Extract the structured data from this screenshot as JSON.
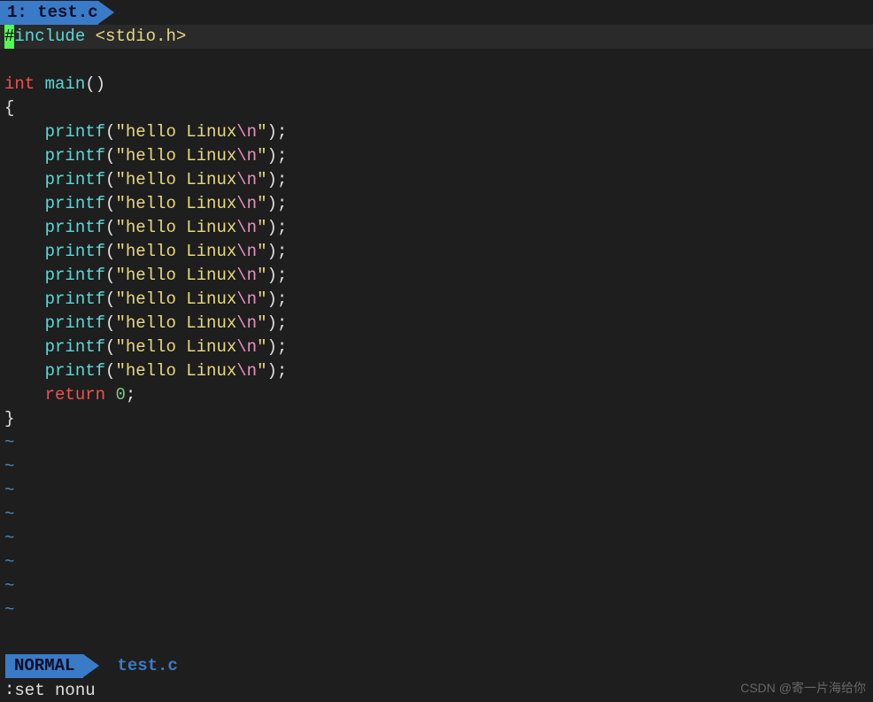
{
  "tab": {
    "label": " 1: test.c "
  },
  "code": {
    "line1": {
      "cursor_char": "#",
      "include_kw": "include",
      "space": " ",
      "header": "<stdio.h>"
    },
    "blank": "",
    "line3": {
      "int_kw": "int",
      "space": " ",
      "main_fn": "main",
      "parens": "()"
    },
    "brace_open": "{",
    "printf_lines": [
      {
        "indent": "    ",
        "fn": "printf",
        "paren_open": "(",
        "str_open": "\"",
        "str_body": "hello Linux",
        "escape": "\\n",
        "str_close": "\"",
        "paren_close": ")",
        "semi": ";"
      },
      {
        "indent": "    ",
        "fn": "printf",
        "paren_open": "(",
        "str_open": "\"",
        "str_body": "hello Linux",
        "escape": "\\n",
        "str_close": "\"",
        "paren_close": ")",
        "semi": ";"
      },
      {
        "indent": "    ",
        "fn": "printf",
        "paren_open": "(",
        "str_open": "\"",
        "str_body": "hello Linux",
        "escape": "\\n",
        "str_close": "\"",
        "paren_close": ")",
        "semi": ";"
      },
      {
        "indent": "    ",
        "fn": "printf",
        "paren_open": "(",
        "str_open": "\"",
        "str_body": "hello Linux",
        "escape": "\\n",
        "str_close": "\"",
        "paren_close": ")",
        "semi": ";"
      },
      {
        "indent": "    ",
        "fn": "printf",
        "paren_open": "(",
        "str_open": "\"",
        "str_body": "hello Linux",
        "escape": "\\n",
        "str_close": "\"",
        "paren_close": ")",
        "semi": ";"
      },
      {
        "indent": "    ",
        "fn": "printf",
        "paren_open": "(",
        "str_open": "\"",
        "str_body": "hello Linux",
        "escape": "\\n",
        "str_close": "\"",
        "paren_close": ")",
        "semi": ";"
      },
      {
        "indent": "    ",
        "fn": "printf",
        "paren_open": "(",
        "str_open": "\"",
        "str_body": "hello Linux",
        "escape": "\\n",
        "str_close": "\"",
        "paren_close": ")",
        "semi": ";"
      },
      {
        "indent": "    ",
        "fn": "printf",
        "paren_open": "(",
        "str_open": "\"",
        "str_body": "hello Linux",
        "escape": "\\n",
        "str_close": "\"",
        "paren_close": ")",
        "semi": ";"
      },
      {
        "indent": "    ",
        "fn": "printf",
        "paren_open": "(",
        "str_open": "\"",
        "str_body": "hello Linux",
        "escape": "\\n",
        "str_close": "\"",
        "paren_close": ")",
        "semi": ";"
      },
      {
        "indent": "    ",
        "fn": "printf",
        "paren_open": "(",
        "str_open": "\"",
        "str_body": "hello Linux",
        "escape": "\\n",
        "str_close": "\"",
        "paren_close": ")",
        "semi": ";"
      },
      {
        "indent": "    ",
        "fn": "printf",
        "paren_open": "(",
        "str_open": "\"",
        "str_body": "hello Linux",
        "escape": "\\n",
        "str_close": "\"",
        "paren_close": ")",
        "semi": ";"
      }
    ],
    "return_line": {
      "indent": "    ",
      "return_kw": "return",
      "space": " ",
      "value": "0",
      "semi": ";"
    },
    "brace_close": "}"
  },
  "tilde_count": 8,
  "tilde_char": "~",
  "status": {
    "mode": "NORMAL",
    "filename": "test.c"
  },
  "command": {
    "prefix": ":",
    "text": "set nonu"
  },
  "watermark": "CSDN @寄一片海给你"
}
